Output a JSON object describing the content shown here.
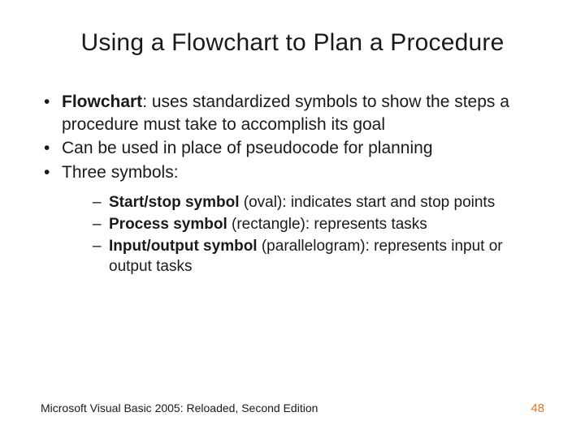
{
  "title": "Using a Flowchart to Plan a Procedure",
  "bullets": [
    {
      "bold": "Flowchart",
      "rest": ": uses standardized symbols to show the steps a procedure must take to accomplish its goal"
    },
    {
      "text": "Can be used in place of pseudocode for planning"
    },
    {
      "text": "Three symbols:"
    }
  ],
  "subbullets": [
    {
      "bold": "Start/stop symbol",
      "rest": " (oval): indicates start and stop points"
    },
    {
      "bold": "Process symbol",
      "rest": " (rectangle): represents tasks"
    },
    {
      "bold": "Input/output symbol",
      "rest": " (parallelogram): represents input or output tasks"
    }
  ],
  "footer": {
    "left": "Microsoft Visual Basic 2005: Reloaded, Second Edition",
    "page": "48"
  }
}
